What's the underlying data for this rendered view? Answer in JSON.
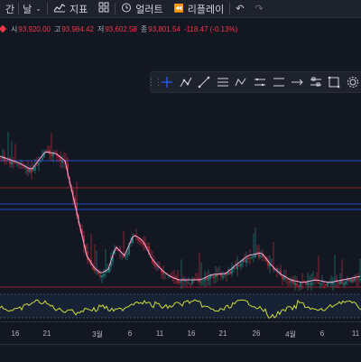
{
  "toolbar": {
    "interval_label": "간",
    "interval_value": "날",
    "indicators_label": "지표",
    "alert_label": "얼러트",
    "replay_label": "리플레이"
  },
  "legend": {
    "open_label": "시",
    "open_value": "93,920.00",
    "high_label": "고",
    "high_value": "93,984.42",
    "low_label": "저",
    "low_value": "93,602.58",
    "close_label": "종",
    "close_value": "93,801.54",
    "change": "-118.47 (-0.13%)"
  },
  "drawing_tools": [
    "cursor-cross-icon",
    "trend-pattern-icon",
    "trend-line-icon",
    "fib-retracement-icon",
    "abcd-pattern-icon",
    "measure-icon",
    "channel-icon",
    "path-icon",
    "range-icon",
    "rectangle-icon",
    "settings-icon"
  ],
  "x_axis_labels": [
    "16",
    "21",
    "3월",
    "6",
    "11",
    "16",
    "21",
    "26",
    "4월",
    "6",
    "11"
  ],
  "colors": {
    "up": "#26a69a",
    "down": "#f23645",
    "ma": "#f7a8d8",
    "oscillator": "#cddc39",
    "hline_blue": "#2962ff",
    "hline_red": "#b22833"
  }
}
